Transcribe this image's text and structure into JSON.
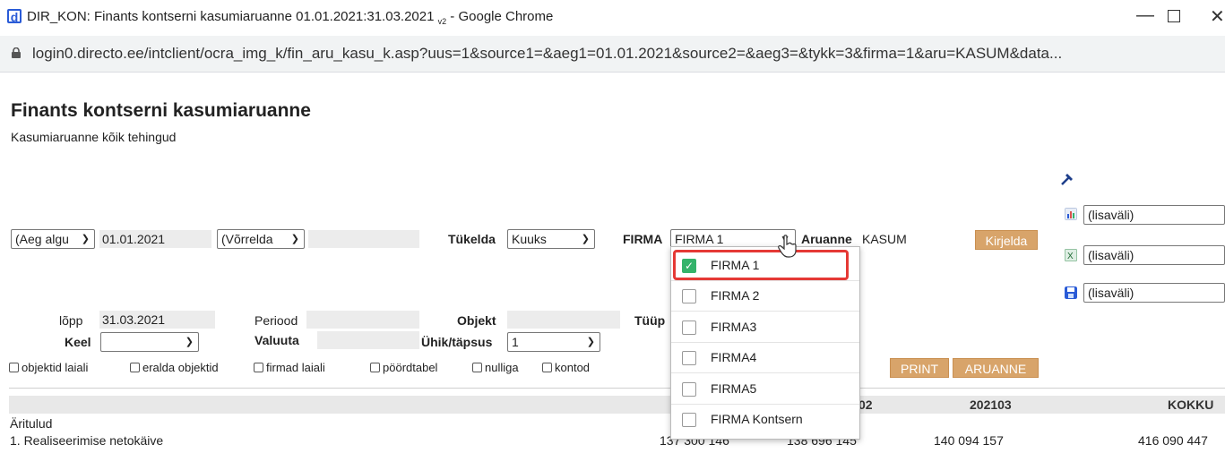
{
  "window": {
    "title": "DIR_KON: Finants kontserni kasumiaruanne 01.01.2021:31.03.2021",
    "version_suffix": "v2",
    "app_suffix": " - Google Chrome",
    "url": "login0.directo.ee/intclient/ocra_img_k/fin_aru_kasu_k.asp?uus=1&source1=&aeg1=01.01.2021&source2=&aeg3=&tykk=3&firma=1&aru=KASUM&data..."
  },
  "page": {
    "title": "Finants kontserni kasumiaruanne",
    "subtitle": "Kasumiaruanne kõik tehingud"
  },
  "form": {
    "aeg_select": "(Aeg algu",
    "start_date": "01.01.2021",
    "compare_select": "(Võrrelda",
    "compare_value": "",
    "tukelda_label": "Tükelda",
    "tukelda_value": "Kuuks",
    "firma_label": "FIRMA",
    "firma_value": "FIRMA 1",
    "aruanne_label": "Aruanne",
    "aruanne_value": "KASUM",
    "kirjelda_button": "Kirjelda",
    "lopp_label": "lõpp",
    "end_date": "31.03.2021",
    "periood_label": "Periood",
    "periood_value": "",
    "objekt_label": "Objekt",
    "objekt_value": "",
    "tuup_label": "Tüüp",
    "keel_label": "Keel",
    "keel_value": "",
    "valuuta_label": "Valuuta",
    "valuuta_value": "",
    "uhik_label": "Ühik/täpsus",
    "uhik_value": "1",
    "print_button": "PRINT",
    "aruanne_button": "ARUANNE"
  },
  "checkboxes": [
    {
      "label": "objektid laiali"
    },
    {
      "label": "eralda objektid"
    },
    {
      "label": "firmad laiali"
    },
    {
      "label": "pöördtabel"
    },
    {
      "label": "nulliga"
    },
    {
      "label": "kontod"
    }
  ],
  "side_panel": {
    "lisavali_1": "(lisaväli)",
    "lisavali_2": "(lisaväli)",
    "lisavali_3": "(lisaväli)"
  },
  "firma_dropdown": {
    "options": [
      {
        "label": "FIRMA 1",
        "checked": true
      },
      {
        "label": "FIRMA 2",
        "checked": false
      },
      {
        "label": "FIRMA3",
        "checked": false
      },
      {
        "label": "FIRMA4",
        "checked": false
      },
      {
        "label": "FIRMA5",
        "checked": false
      },
      {
        "label": "FIRMA Kontsern",
        "checked": false
      }
    ]
  },
  "table": {
    "columns": [
      "02",
      "202103",
      "KOKKU"
    ],
    "section": "Äritulud",
    "rows": [
      {
        "label": "1. Realiseerimise netokäive",
        "values": [
          "137 300 146",
          "138 696 145",
          "140 094 157",
          "416 090 447"
        ]
      }
    ]
  },
  "colors": {
    "accent_button": "#d8a46a",
    "check_green": "#34b36b",
    "highlight_red": "#e53935"
  }
}
